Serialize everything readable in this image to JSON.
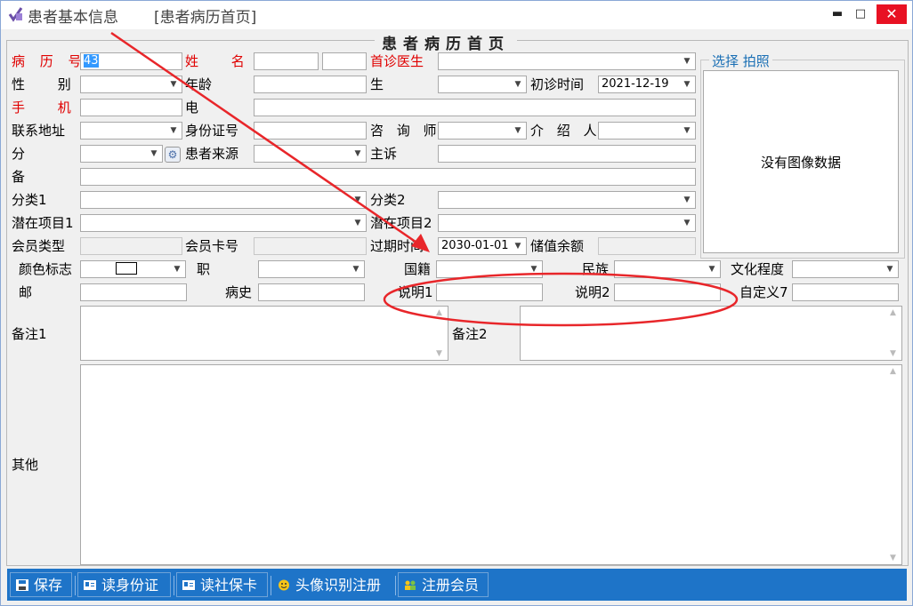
{
  "window": {
    "title": "患者基本信息",
    "tab": "[患者病历首页]",
    "minimize": "▬",
    "maximize": "□",
    "close": "✕"
  },
  "form": {
    "title": "患者病历首页",
    "record_no": {
      "label": "病 历 号",
      "value": "43"
    },
    "name": {
      "label": "姓 名"
    },
    "first_doctor": {
      "label": "首诊医生"
    },
    "gender": {
      "label": "性 别"
    },
    "age": {
      "label": "年龄"
    },
    "birthday": {
      "label": "生 日"
    },
    "first_visit": {
      "label": "初诊时间",
      "value": "2021-12-19"
    },
    "mobile": {
      "label": "手 机"
    },
    "phone": {
      "label": "电 话"
    },
    "address": {
      "label": "联系地址"
    },
    "id_card": {
      "label": "身份证号"
    },
    "consultant": {
      "label": "咨 询 师"
    },
    "referrer": {
      "label": "介 绍 人"
    },
    "category": {
      "label": "分 类"
    },
    "source": {
      "label": "患者来源"
    },
    "complaint": {
      "label": "主诉"
    },
    "remark": {
      "label": "备 注"
    },
    "category1": {
      "label": "分类1"
    },
    "category2": {
      "label": "分类2"
    },
    "potential1": {
      "label": "潜在项目1"
    },
    "potential2": {
      "label": "潜在项目2"
    },
    "member_type": {
      "label": "会员类型"
    },
    "member_card": {
      "label": "会员卡号"
    },
    "expire": {
      "label": "过期时间",
      "value": "2030-01-01"
    },
    "balance": {
      "label": "储值余额"
    },
    "color_tag": {
      "label": "颜色标志"
    },
    "occupation": {
      "label": "职 业"
    },
    "nationality": {
      "label": "国籍"
    },
    "ethnicity": {
      "label": "民族"
    },
    "education": {
      "label": "文化程度"
    },
    "email": {
      "label": "邮 箱"
    },
    "history": {
      "label": "病史"
    },
    "note1": {
      "label": "说明1"
    },
    "note2": {
      "label": "说明2"
    },
    "custom7": {
      "label": "自定义7"
    },
    "remark1": {
      "label": "备注1"
    },
    "remark2": {
      "label": "备注2"
    },
    "other": {
      "label": "其他"
    }
  },
  "photo": {
    "select": "选择",
    "capture": "拍照",
    "empty": "没有图像数据"
  },
  "toolbar": {
    "save": "保存",
    "read_id": "读身份证",
    "read_social": "读社保卡",
    "face_register": "头像识别注册",
    "register_member": "注册会员"
  },
  "colors": {
    "required_label": "#e00000",
    "toolbar_bg": "#1e74c8",
    "annotation": "#e8262a",
    "close_button": "#e81123"
  }
}
